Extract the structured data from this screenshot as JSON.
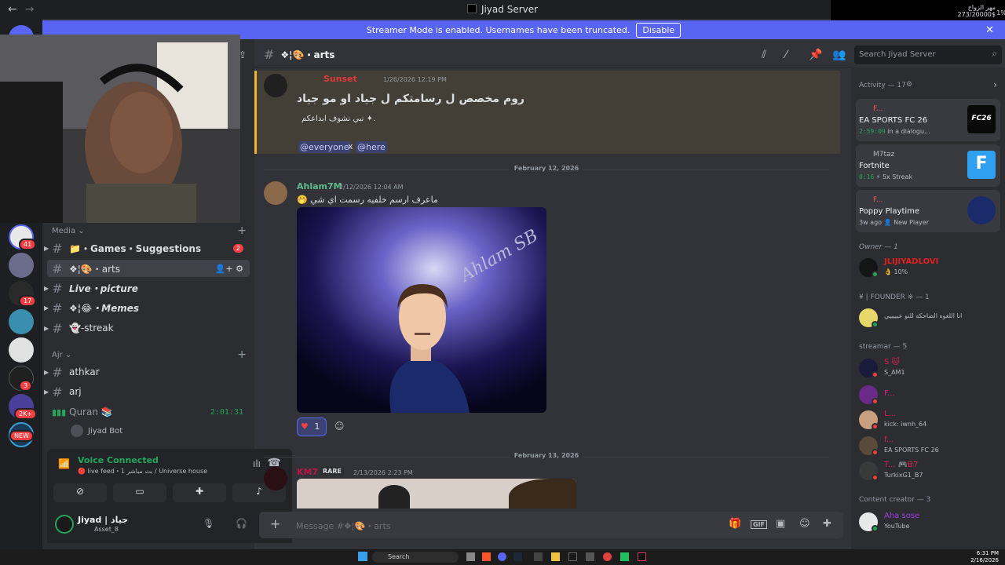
{
  "window": {
    "title": "Jiyad Server",
    "back": "←",
    "forward": "→"
  },
  "alert_overlay": {
    "line1": "مهر الزواج",
    "line2": "273/20000$",
    "percent": "1%"
  },
  "banner": {
    "text": "Streamer Mode is enabled. Usernames have been truncated.",
    "button": "Disable",
    "close": "✕"
  },
  "guild_badges": [
    "41",
    "17",
    "3",
    "2K+",
    "NEW"
  ],
  "sidebar": {
    "categories": [
      {
        "label": "Media ⌄",
        "add": "+"
      },
      {
        "label": "Ajr ⌄",
        "add": "+"
      }
    ],
    "channels": [
      {
        "name": "📁・Games・Suggestions",
        "badge": "2"
      },
      {
        "name": "❖¦🎨・arts"
      },
      {
        "name": "Live・picture"
      },
      {
        "name": "❖¦😂・Memes"
      },
      {
        "name": "👻-streak"
      },
      {
        "name": "athkar"
      },
      {
        "name": "arj"
      },
      {
        "name": "Quran 📚",
        "time": "2:01:31"
      }
    ],
    "bot": "Jiyad Bot"
  },
  "voice": {
    "status": "Voice Connected",
    "sub": "🔴 live feed・بث مباشر 1 / Universe house"
  },
  "user": {
    "name": "Jiyad | جياد",
    "status": "Asset_8"
  },
  "chat": {
    "channel": "❖¦🎨・arts",
    "search_placeholder": "Search Jiyad Server",
    "messages": [
      {
        "author": "Sunset",
        "time": "1/26/2026 12:19 PM",
        "line1": "روم مخصص ل رسامتكم ل جياد او مو جياد",
        "line2": "نبي نشوف ابداعكم ✦.",
        "mentions": [
          "@everyone",
          "x",
          "@here"
        ]
      },
      {
        "author": "Ahlam7M",
        "time": "2/12/2026 12:04 AM",
        "line1": "🤭 ماعرف ارسم خلفيه رسمت اي شي",
        "reaction_count": "1",
        "art_signature": "Ahlam SB"
      },
      {
        "author": "KM7",
        "tag": "RARE",
        "time": "2/13/2026 2:23 PM"
      }
    ],
    "dividers": [
      "February 12, 2026",
      "February 13, 2026"
    ],
    "input_placeholder": "Message #❖¦🎨・arts"
  },
  "members": {
    "activity_header": "Activity — 17",
    "activities": [
      {
        "user": "F...",
        "game": "EA SPORTS FC 26",
        "time": "2:59:09",
        "detail": "in a dialogu...",
        "art": "FC26"
      },
      {
        "user": "M7taz",
        "game": "Fortnite",
        "time": "0:16",
        "detail": "5x Streak",
        "art": "F"
      },
      {
        "user": "F...",
        "game": "Poppy Playtime",
        "time": "3w ago",
        "detail": "New Player",
        "art": ""
      }
    ],
    "groups": [
      {
        "header": "Owner — 1",
        "members": [
          {
            "name": "JLIJIYADLOVI",
            "status": "👌 10%"
          }
        ]
      },
      {
        "header": "¥ | FOUNDER ※ — 1",
        "members": [
          {
            "name": "انا اللغوه الضاحكه للتو عيييييي",
            "status": ""
          }
        ]
      },
      {
        "header": "streamar — 5",
        "members": [
          {
            "name": "S 🐱",
            "status": "S_AM1"
          },
          {
            "name": "F...",
            "status": ""
          },
          {
            "name": "L...",
            "status": "kick: iwnh_64"
          },
          {
            "name": "f...",
            "status": "EA SPORTS FC 26"
          },
          {
            "name": "T... 🎮B7",
            "status": "TurkixG1_B7"
          }
        ]
      },
      {
        "header": "Content creator — 3",
        "members": [
          {
            "name": "Aha sose",
            "status": "YouTube"
          }
        ]
      }
    ]
  },
  "taskbar": {
    "search": "Search",
    "time": "6:31 PM",
    "date": "2/16/2026"
  },
  "colors": {
    "blurple": "#5865f2",
    "online": "#23a55a",
    "dnd": "#f23f43",
    "mention_bg": "#3c4270"
  }
}
